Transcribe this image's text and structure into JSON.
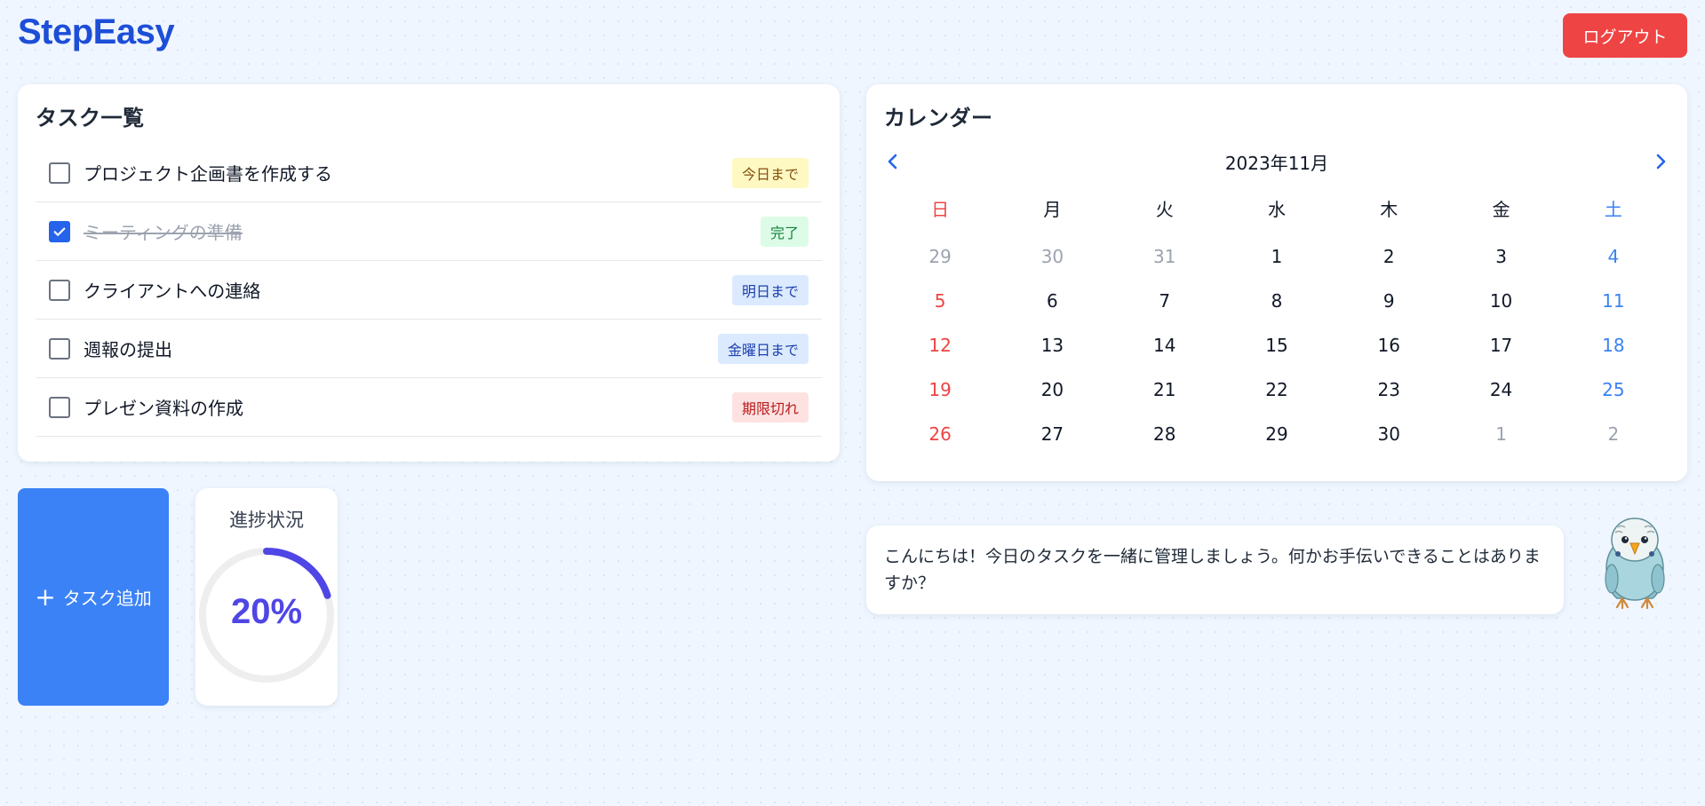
{
  "header": {
    "logo": "StepEasy",
    "logout_label": "ログアウト"
  },
  "tasks": {
    "title": "タスク一覧",
    "items": [
      {
        "label": "プロジェクト企画書を作成する",
        "checked": false,
        "badge": "今日まで",
        "badge_color": "#fef9c3"
      },
      {
        "label": "ミーティングの準備",
        "checked": true,
        "badge": "完了",
        "badge_color": "#dcfce7"
      },
      {
        "label": "クライアントへの連絡",
        "checked": false,
        "badge": "明日まで",
        "badge_color": "#dbeafe"
      },
      {
        "label": "週報の提出",
        "checked": false,
        "badge": "金曜日まで",
        "badge_color": "#dbeafe"
      },
      {
        "label": "プレゼン資料の作成",
        "checked": false,
        "badge": "期限切れ",
        "badge_color": "#fee2e2"
      }
    ]
  },
  "calendar": {
    "title": "カレンダー",
    "month_label": "2023年11月",
    "prev_icon": "chevron-left-icon",
    "next_icon": "chevron-right-icon",
    "weekdays": [
      "日",
      "月",
      "火",
      "水",
      "木",
      "金",
      "土"
    ],
    "weeks": [
      [
        "29",
        "30",
        "31",
        "1",
        "2",
        "3",
        "4"
      ],
      [
        "5",
        "6",
        "7",
        "8",
        "9",
        "10",
        "11"
      ],
      [
        "12",
        "13",
        "14",
        "15",
        "16",
        "17",
        "18"
      ],
      [
        "19",
        "20",
        "21",
        "22",
        "23",
        "24",
        "25"
      ],
      [
        "26",
        "27",
        "28",
        "29",
        "30",
        "1",
        "2"
      ]
    ],
    "sunday_color": "#ef4444",
    "saturday_color": "#3b82f6",
    "muted_color": "#9ca3af"
  },
  "actions": {
    "add_task_label": "タスク追加",
    "add_icon": "plus-icon"
  },
  "progress": {
    "title": "進捗状況",
    "percent_label": "20%",
    "value": 0.2,
    "color": "#4f46e5"
  },
  "assistant": {
    "message": "こんにちは！今日のタスクを一緒に管理しましょう。何かお手伝いできることはありますか？",
    "avatar_icon": "budgie-mascot-icon"
  },
  "colors": {
    "brand": "#1d4ed8",
    "accent": "#3b82f6",
    "danger": "#ef4444",
    "background": "#eff6ff"
  }
}
